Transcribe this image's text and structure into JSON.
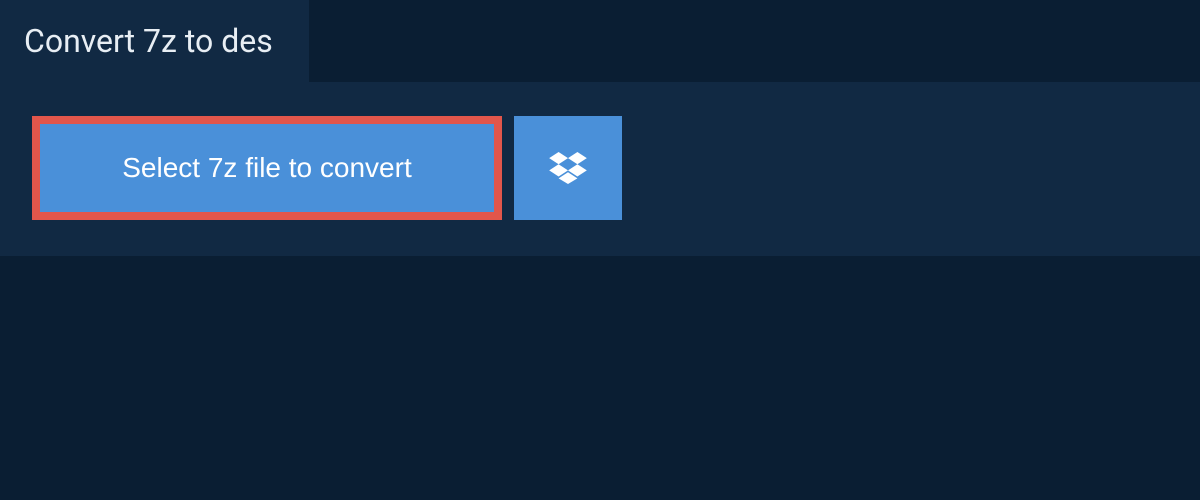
{
  "header": {
    "title": "Convert 7z to des"
  },
  "actions": {
    "select_file_label": "Select 7z file to convert"
  }
}
